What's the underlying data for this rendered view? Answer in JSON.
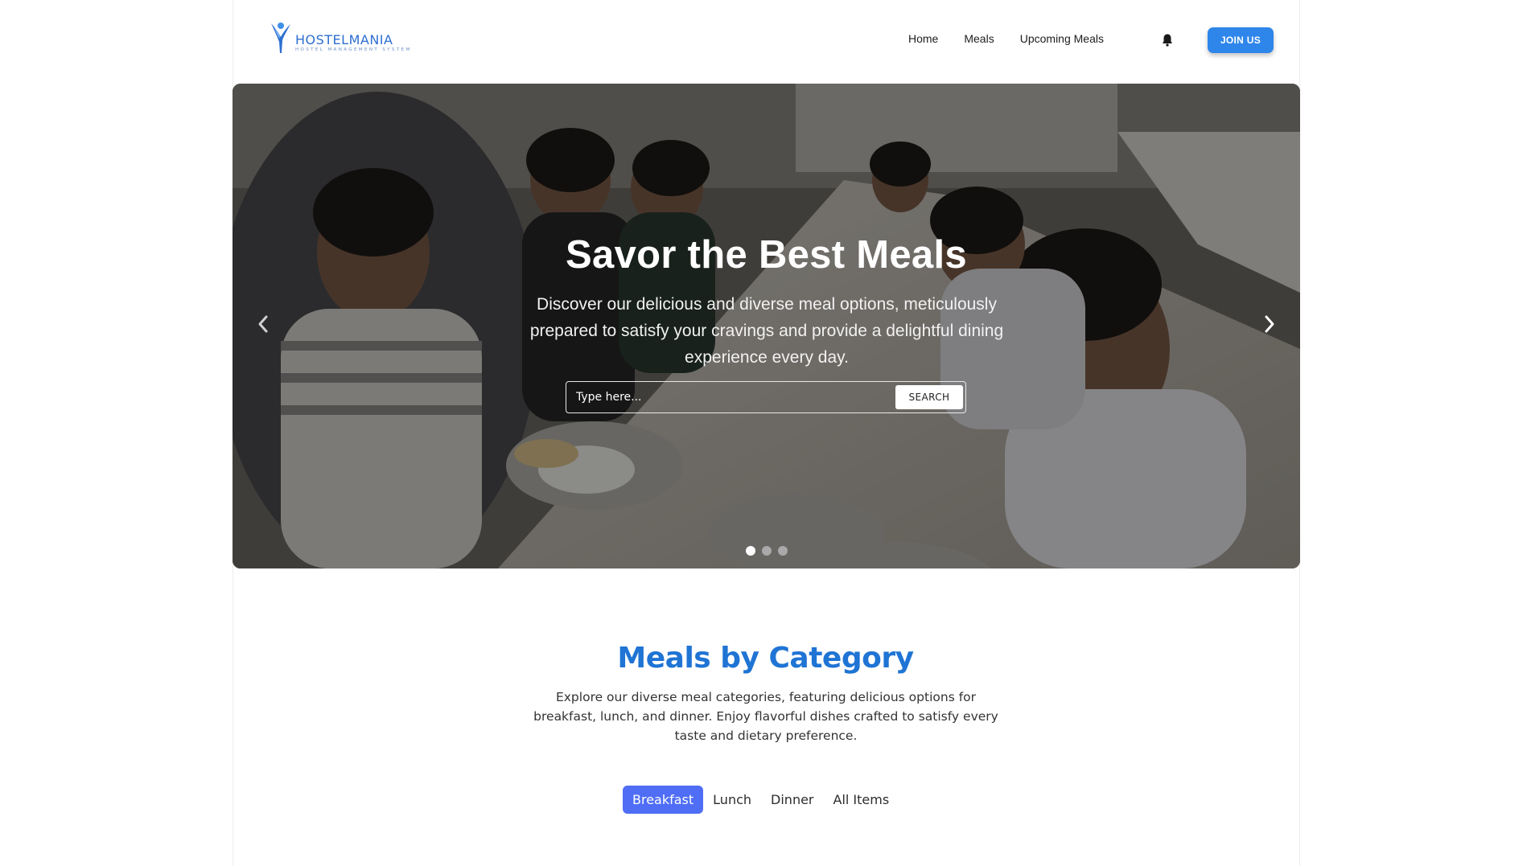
{
  "nav": {
    "logo_title": "HOSTELMANIA",
    "logo_tagline": "HOSTEL MANAGEMENT SYSTEM",
    "links": [
      "Home",
      "Meals",
      "Upcoming Meals"
    ],
    "join_label": "JOIN US"
  },
  "hero": {
    "title": "Savor the Best Meals",
    "subtitle": "Discover our delicious and diverse meal options, meticulously prepared to satisfy your cravings and provide a delightful dining experience every day.",
    "search_placeholder": "Type here...",
    "search_button": "SEARCH",
    "slide_count": 3,
    "active_slide": 1
  },
  "categories": {
    "title": "Meals by Category",
    "description": "Explore our diverse meal categories, featuring delicious options for breakfast, lunch, and dinner. Enjoy flavorful dishes crafted to satisfy every taste and dietary preference.",
    "tabs": [
      "Breakfast",
      "Lunch",
      "Dinner",
      "All Items"
    ],
    "active_tab": "Breakfast"
  },
  "colors": {
    "brand": "#2e6fd1",
    "join_button": "#2f86ea",
    "category_title": "#1f74d4",
    "active_tab": "#4f6df5"
  },
  "icons": [
    "logo-mark-icon",
    "bell-icon",
    "chevron-left-icon",
    "chevron-right-icon"
  ]
}
